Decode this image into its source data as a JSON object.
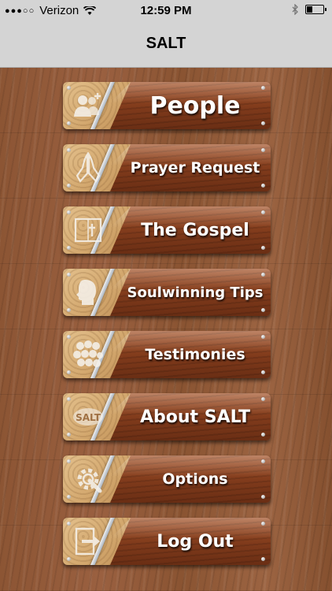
{
  "status_bar": {
    "carrier": "Verizon",
    "signal_dots": "●●●○○",
    "time": "12:59 PM",
    "battery_percent": 35
  },
  "nav": {
    "title": "SALT"
  },
  "menu": [
    {
      "label": "People",
      "icon": "people-icon"
    },
    {
      "label": "Prayer Request",
      "icon": "praying-hands-icon"
    },
    {
      "label": "The Gospel",
      "icon": "bible-icon"
    },
    {
      "label": "Soulwinning Tips",
      "icon": "head-profile-icon"
    },
    {
      "label": "Testimonies",
      "icon": "crowd-icon"
    },
    {
      "label": "About SALT",
      "icon": "salt-badge-icon",
      "icon_text": "SALT"
    },
    {
      "label": "Options",
      "icon": "gear-wrench-icon"
    },
    {
      "label": "Log Out",
      "icon": "logout-icon"
    }
  ],
  "colors": {
    "nav_background": "#d4d4d4",
    "button_wood": "#8a4220",
    "button_label": "#ffffff"
  }
}
